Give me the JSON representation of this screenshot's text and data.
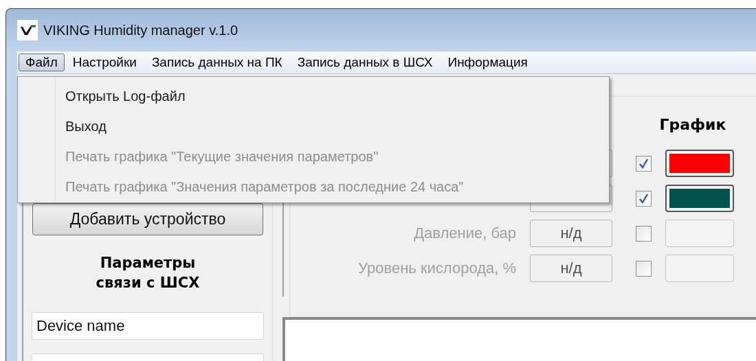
{
  "window": {
    "title": "VIKING Humidity manager v.1.0"
  },
  "menu_bar": [
    {
      "label": "Файл",
      "selected": true
    },
    {
      "label": "Настройки",
      "selected": false
    },
    {
      "label": "Запись данных на ПК",
      "selected": false
    },
    {
      "label": "Запись данных в ШСХ",
      "selected": false
    },
    {
      "label": "Информация",
      "selected": false
    }
  ],
  "dropdown_menu": [
    {
      "label": "Открыть Log-файл",
      "disabled": false
    },
    {
      "label": "Выход",
      "disabled": false
    },
    {
      "label": "Печать графика \"Текущие значения параметров\"",
      "disabled": true
    },
    {
      "label": "Печать графика \"Значения параметров за последние 24 часа\"",
      "disabled": true
    }
  ],
  "left_panel": {
    "add_button": "Добавить устройство",
    "heading": "Параметры\nсвязи с ШСХ",
    "fields": [
      {
        "value": "Device name"
      }
    ]
  },
  "parameters": {
    "graph_heading": "График",
    "rows": [
      {
        "checked": true,
        "color": "#ff0000"
      },
      {
        "checked": true,
        "color": "#00524f"
      },
      {
        "label": "Давление, бар",
        "value": "н/д",
        "enabled": false,
        "checked": false
      },
      {
        "label": "Уровень кислорода, %",
        "value": "н/д",
        "enabled": false,
        "checked": false
      }
    ]
  }
}
